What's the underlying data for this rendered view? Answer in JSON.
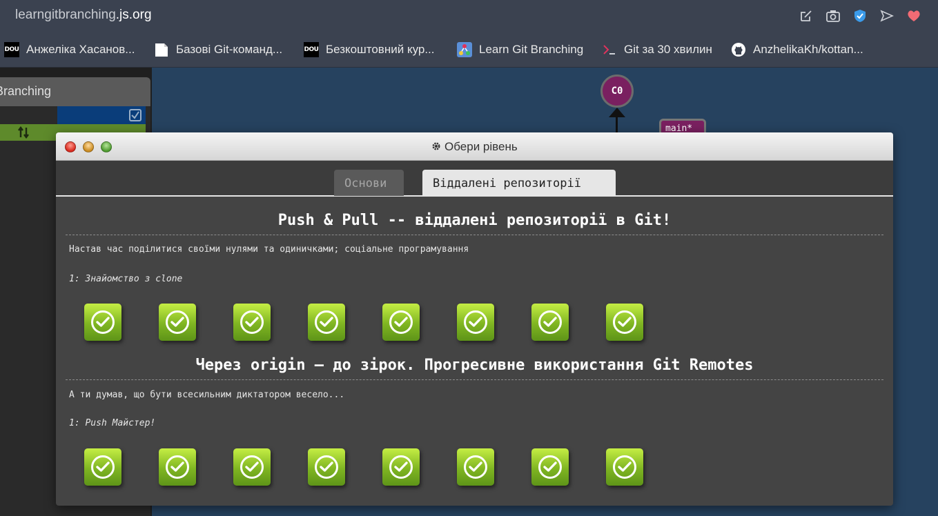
{
  "browser": {
    "url_prefix": "learngitbranching",
    "url_domain": ".js.org",
    "bookmarks": [
      {
        "label": "Анжеліка Хасанов...",
        "icon": "dou-icon"
      },
      {
        "label": "Базові Git-команд...",
        "icon": "page-icon"
      },
      {
        "label": "Безкоштовний кур...",
        "icon": "dou-icon"
      },
      {
        "label": "Learn Git Branching",
        "icon": "git-branching-icon"
      },
      {
        "label": "Git за 30 хвилин",
        "icon": "terminal-icon"
      },
      {
        "label": "AnzhelikaKh/kottan...",
        "icon": "github-icon"
      }
    ],
    "dou_text": "DOU"
  },
  "background": {
    "panel_title": "Branching",
    "node_label": "C0",
    "branch_label": "main*"
  },
  "dialog": {
    "title": "Обери рівень",
    "tabs": [
      {
        "label": "Основи",
        "active": false
      },
      {
        "label": "Віддалені репозиторії",
        "active": true
      }
    ],
    "sections": [
      {
        "title": "Push & Pull -- віддалені репозиторії в Git!",
        "description": "Настав час поділитися своїми нулями та одиничками; соціальне програмування",
        "current_level": "1: Знайомство з clone",
        "levels_completed": 8
      },
      {
        "title": "Через origin – до зірок. Прогресивне використання Git Remotes",
        "description": "А ти думав, що бути всесильним диктатором весело...",
        "current_level": "1: Push Майстер!",
        "levels_completed": 8
      }
    ]
  },
  "colors": {
    "level_complete": "#7fb522",
    "background": "#26425f"
  }
}
